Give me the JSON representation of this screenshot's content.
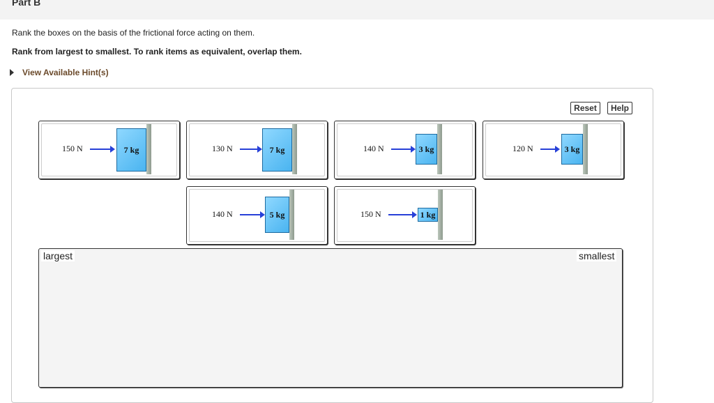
{
  "header": {
    "part": "Part B"
  },
  "prompt": {
    "line1": "Rank the boxes on the basis of the frictional force acting on them.",
    "line2": "Rank from largest to smallest. To rank items as equivalent, overlap them."
  },
  "hint": {
    "label": "View Available Hint(s)"
  },
  "toolbar": {
    "reset_label": "Reset",
    "help_label": "Help"
  },
  "cards": [
    {
      "force": "150 N",
      "mass": "7 kg"
    },
    {
      "force": "130 N",
      "mass": "7 kg"
    },
    {
      "force": "140 N",
      "mass": "3 kg"
    },
    {
      "force": "120 N",
      "mass": "3 kg"
    },
    {
      "force": "140 N",
      "mass": "5 kg"
    },
    {
      "force": "150 N",
      "mass": "1 kg"
    }
  ],
  "ranking": {
    "left_label": "largest",
    "right_label": "smallest"
  },
  "colors": {
    "arrow": "#2740d8",
    "box": "#4ab4f0",
    "hint_text": "#6b4a2b"
  }
}
